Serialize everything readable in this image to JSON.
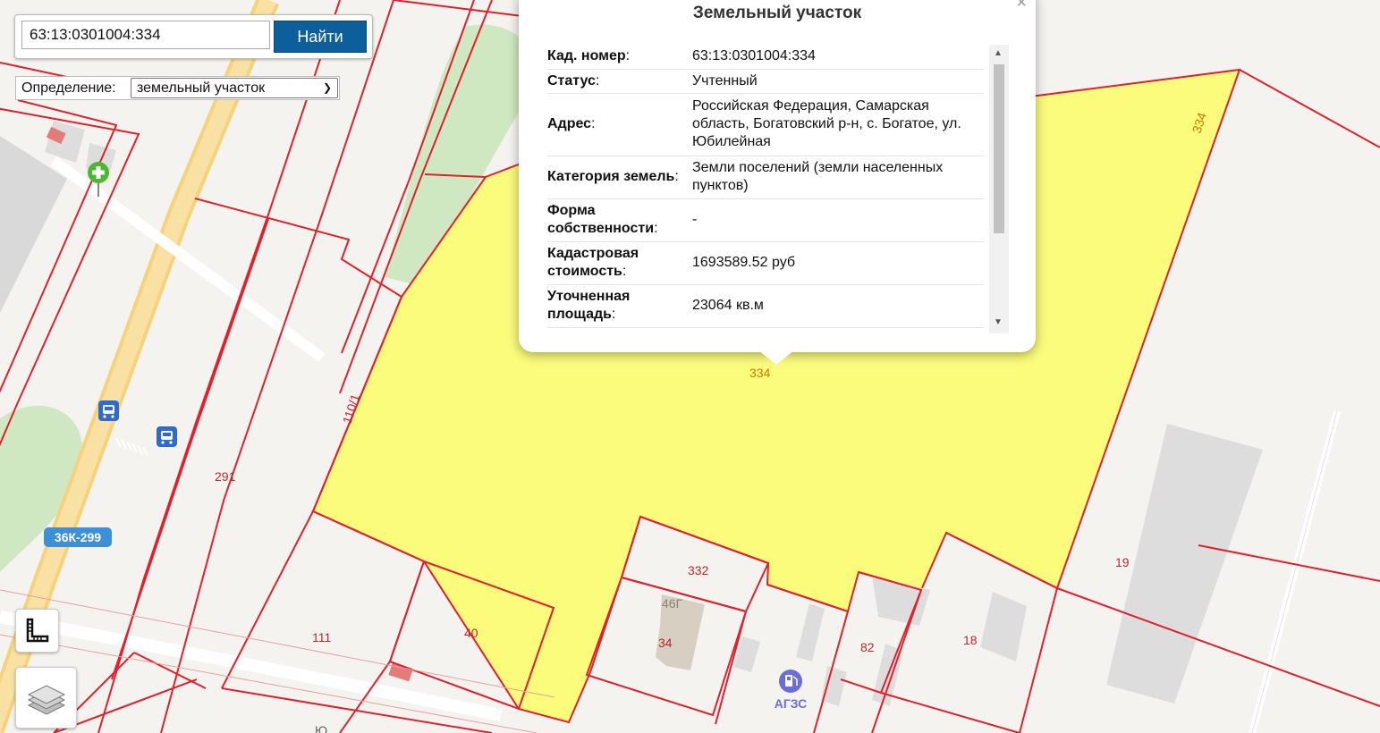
{
  "search": {
    "value": "63:13:0301004:334",
    "button_label": "Найти"
  },
  "definition": {
    "label": "Определение:",
    "selected": "земельный участок"
  },
  "popup": {
    "title": "Земельный участок",
    "rows": [
      {
        "key": "Кад. номер",
        "value": "63:13:0301004:334"
      },
      {
        "key": "Статус",
        "value": "Учтенный"
      },
      {
        "key": "Адрес",
        "value": "Российская Федерация, Самарская область, Богатовский р-н, с. Богатое, ул. Юбилейная"
      },
      {
        "key": "Категория земель",
        "value": "Земли поселений (земли населенных пунктов)"
      },
      {
        "key": "Форма собственности",
        "value": "-"
      },
      {
        "key": "Кадастровая стоимость",
        "value": "1693589.52 руб"
      },
      {
        "key": "Уточненная площадь",
        "value": "23064 кв.м"
      }
    ]
  },
  "map": {
    "parcel_labels": {
      "p334_top": "334",
      "p334_center": "334",
      "p110": "110/1",
      "p291": "291",
      "p111": "111",
      "p40": "40",
      "p332": "332",
      "p34": "34",
      "p82": "82",
      "p18": "18",
      "p19": "19"
    },
    "building_label": "46Г",
    "road_sign": "36К-299",
    "gas_station": "АГЗС",
    "street_fragment": "Ю"
  },
  "colors": {
    "selected_parcel": "#fbfb7c",
    "parcel_border": "#e0202c",
    "search_button": "#0d5f9b"
  },
  "icons": [
    "pharmacy-icon",
    "bus-stop-icon",
    "gas-station-icon",
    "ruler-icon",
    "layers-icon",
    "close-icon",
    "chevron-down-icon"
  ]
}
